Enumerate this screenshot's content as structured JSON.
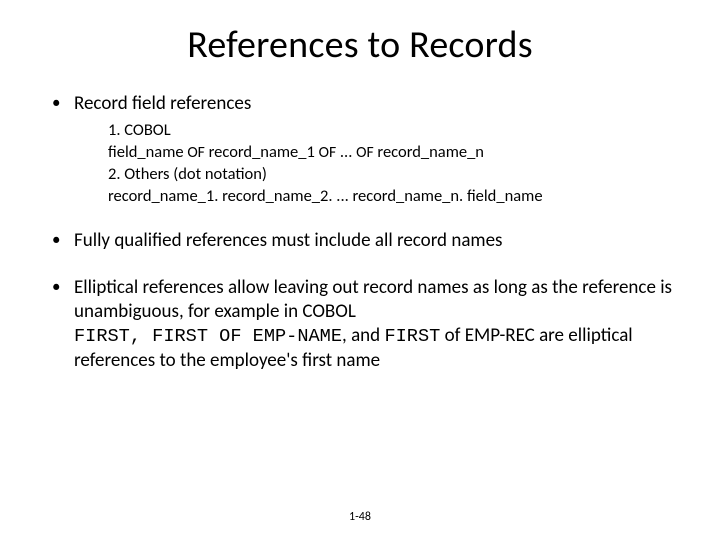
{
  "title": "References to Records",
  "bullets": {
    "b0": {
      "head": "Record field references",
      "sub": {
        "l0": "1. COBOL",
        "l1a": "field_name ",
        "l1b": "OF",
        "l1c": " record_name_1 ",
        "l1d": "OF",
        "l1e": " ... ",
        "l1f": "OF",
        "l1g": " record_name_n",
        "l2": "2. Others (dot notation)",
        "l3": "record_name_1. record_name_2. ... record_name_n. field_name"
      }
    },
    "b1": {
      "text": "Fully qualified references must include all record names"
    },
    "b2": {
      "pre": "Elliptical references allow leaving out record names as long as the reference is unambiguous, for example in COBOL",
      "code1": "FIRST, FIRST OF EMP-NAME",
      "mid": ", and ",
      "code2": "FIRST",
      "post": " of EMP-REC are elliptical references to the employee's first name"
    }
  },
  "pagenum": "1-48"
}
